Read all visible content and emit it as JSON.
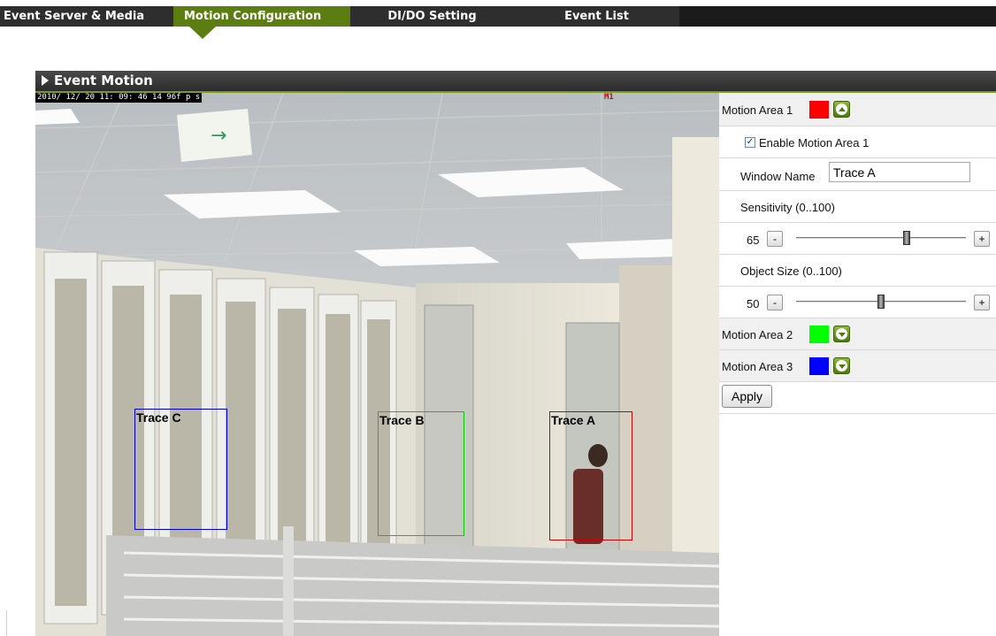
{
  "tabs": [
    {
      "label": "Event Server & Media",
      "active": false
    },
    {
      "label": "Motion Configuration",
      "active": true
    },
    {
      "label": "DI/DO Setting",
      "active": false
    },
    {
      "label": "Event List",
      "active": false
    }
  ],
  "section": {
    "title": "Event Motion"
  },
  "video": {
    "timestamp": "2010/ 12/ 20 11: 09: 46 14 96f p s",
    "marker": "M1",
    "boxes": [
      {
        "label": "Trace C",
        "color": "#0000cc"
      },
      {
        "label": "Trace B",
        "color": "#00cc00"
      },
      {
        "label": "Trace A",
        "color": "#cc0000"
      }
    ]
  },
  "panel": {
    "areas": [
      {
        "label": "Motion Area 1",
        "color": "#ff0000",
        "expanded": true,
        "toggle_icon": "collapse-up-icon"
      },
      {
        "label": "Motion Area 2",
        "color": "#00ff00",
        "expanded": false,
        "toggle_icon": "expand-down-icon"
      },
      {
        "label": "Motion Area 3",
        "color": "#0000ff",
        "expanded": false,
        "toggle_icon": "expand-down-icon"
      }
    ],
    "enable": {
      "label": "Enable Motion Area 1",
      "checked": true
    },
    "window_name": {
      "label": "Window Name",
      "value": "Trace A"
    },
    "sensitivity": {
      "label": "Sensitivity (0..100)",
      "value": 65,
      "minus": "-",
      "plus": "+"
    },
    "object_size": {
      "label": "Object Size (0..100)",
      "value": 50,
      "minus": "-",
      "plus": "+"
    },
    "apply_label": "Apply"
  }
}
